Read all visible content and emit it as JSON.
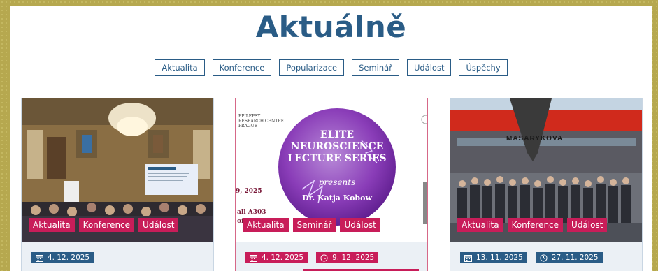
{
  "page": {
    "title": "Aktuálně"
  },
  "filters": [
    "Aktualita",
    "Konference",
    "Popularizace",
    "Seminář",
    "Událost",
    "Úspěchy"
  ],
  "cards": [
    {
      "tags": [
        "Aktualita",
        "Konference",
        "Událost"
      ],
      "date_start": "4. 12. 2025"
    },
    {
      "tags": [
        "Aktualita",
        "Seminář",
        "Událost"
      ],
      "date_start": "4. 12. 2025",
      "date_end": "9. 12. 2025",
      "poster": {
        "org_line1": "EPILEPSY",
        "org_line2": "RESEARCH CENTRE",
        "org_line3": "PRAGUE",
        "circle_line1": "ELITE",
        "circle_line2": "NEUROSCIENCE",
        "circle_line3": "LECTURE SERIES",
        "presents": "presents",
        "speaker": "Dr. Katja Kobow",
        "date_fragment": "9, 2025",
        "hall_fragment": "all A303",
        "bottom_fragment": "of N"
      }
    },
    {
      "tags": [
        "Aktualita",
        "Konference",
        "Událost"
      ],
      "date_start": "13. 11. 2025",
      "date_end": "27. 11. 2025",
      "sign_text": "MASARYKOVA"
    }
  ]
}
